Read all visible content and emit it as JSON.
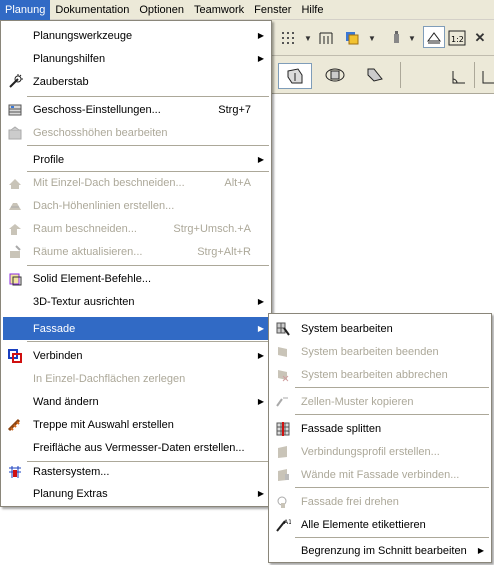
{
  "menubar": {
    "items": [
      "Planung",
      "Dokumentation",
      "Optionen",
      "Teamwork",
      "Fenster",
      "Hilfe"
    ]
  },
  "menu": {
    "items": [
      {
        "label": "Planungswerkzeuge",
        "shortcut": "",
        "submenu": true,
        "disabled": false,
        "icon": "none"
      },
      {
        "label": "Planungshilfen",
        "shortcut": "",
        "submenu": true,
        "disabled": false,
        "icon": "none"
      },
      {
        "label": "Zauberstab",
        "shortcut": "",
        "submenu": false,
        "disabled": false,
        "icon": "magic-wand-icon"
      },
      {
        "label": "Geschoss-Einstellungen...",
        "shortcut": "Strg+7",
        "submenu": false,
        "disabled": false,
        "icon": "story-settings-icon"
      },
      {
        "label": "Geschosshöhen bearbeiten",
        "shortcut": "",
        "submenu": false,
        "disabled": true,
        "icon": "story-heights-icon"
      },
      {
        "label": "Profile",
        "shortcut": "",
        "submenu": true,
        "disabled": false,
        "icon": "none"
      },
      {
        "label": "Mit Einzel-Dach beschneiden...",
        "shortcut": "Alt+A",
        "submenu": false,
        "disabled": true,
        "icon": "trim-roof-icon"
      },
      {
        "label": "Dach-Höhenlinien erstellen...",
        "shortcut": "",
        "submenu": false,
        "disabled": true,
        "icon": "roof-contour-icon"
      },
      {
        "label": "Raum beschneiden...",
        "shortcut": "Strg+Umsch.+A",
        "submenu": false,
        "disabled": true,
        "icon": "trim-zone-icon"
      },
      {
        "label": "Räume aktualisieren...",
        "shortcut": "Strg+Alt+R",
        "submenu": false,
        "disabled": true,
        "icon": "update-zones-icon"
      },
      {
        "label": "Solid Element-Befehle...",
        "shortcut": "",
        "submenu": false,
        "disabled": false,
        "icon": "solid-element-icon"
      },
      {
        "label": "3D-Textur ausrichten",
        "shortcut": "",
        "submenu": true,
        "disabled": false,
        "icon": "none"
      },
      {
        "label": "Fassade",
        "shortcut": "",
        "submenu": true,
        "disabled": false,
        "icon": "none",
        "highlighted": true
      },
      {
        "label": "Verbinden",
        "shortcut": "",
        "submenu": true,
        "disabled": false,
        "icon": "connect-icon"
      },
      {
        "label": "In Einzel-Dachflächen zerlegen",
        "shortcut": "",
        "submenu": false,
        "disabled": true,
        "icon": "none"
      },
      {
        "label": "Wand ändern",
        "shortcut": "",
        "submenu": true,
        "disabled": false,
        "icon": "none"
      },
      {
        "label": "Treppe mit Auswahl erstellen",
        "shortcut": "",
        "submenu": false,
        "disabled": false,
        "icon": "stair-icon"
      },
      {
        "label": "Freifläche aus Vermesser-Daten erstellen...",
        "shortcut": "",
        "submenu": false,
        "disabled": false,
        "icon": "none"
      },
      {
        "label": "Rastersystem...",
        "shortcut": "",
        "submenu": false,
        "disabled": false,
        "icon": "grid-system-icon"
      },
      {
        "label": "Planung Extras",
        "shortcut": "",
        "submenu": true,
        "disabled": false,
        "icon": "none"
      }
    ]
  },
  "submenu": {
    "items": [
      {
        "label": "System bearbeiten",
        "disabled": false,
        "submenu": false,
        "icon": "edit-system-icon"
      },
      {
        "label": "System bearbeiten beenden",
        "disabled": true,
        "submenu": false,
        "icon": "end-edit-icon"
      },
      {
        "label": "System bearbeiten abbrechen",
        "disabled": true,
        "submenu": false,
        "icon": "cancel-edit-icon"
      },
      {
        "label": "Zellen-Muster kopieren",
        "disabled": true,
        "submenu": false,
        "icon": "copy-pattern-icon"
      },
      {
        "label": "Fassade splitten",
        "disabled": false,
        "submenu": false,
        "icon": "split-curtain-wall-icon"
      },
      {
        "label": "Verbindungsprofil erstellen...",
        "disabled": true,
        "submenu": false,
        "icon": "connection-profile-icon"
      },
      {
        "label": "Wände mit Fassade verbinden...",
        "disabled": true,
        "submenu": false,
        "icon": "connect-walls-icon"
      },
      {
        "label": "Fassade frei drehen",
        "disabled": true,
        "submenu": false,
        "icon": "rotate-icon"
      },
      {
        "label": "Alle Elemente etikettieren",
        "disabled": false,
        "submenu": false,
        "icon": "label-all-icon"
      },
      {
        "label": "Begrenzung im Schnitt bearbeiten",
        "disabled": false,
        "submenu": true,
        "icon": "none"
      }
    ]
  },
  "colors": {
    "highlight": "#316ac5",
    "menubar": "#ece9d8",
    "disabled_text": "#aca899"
  }
}
